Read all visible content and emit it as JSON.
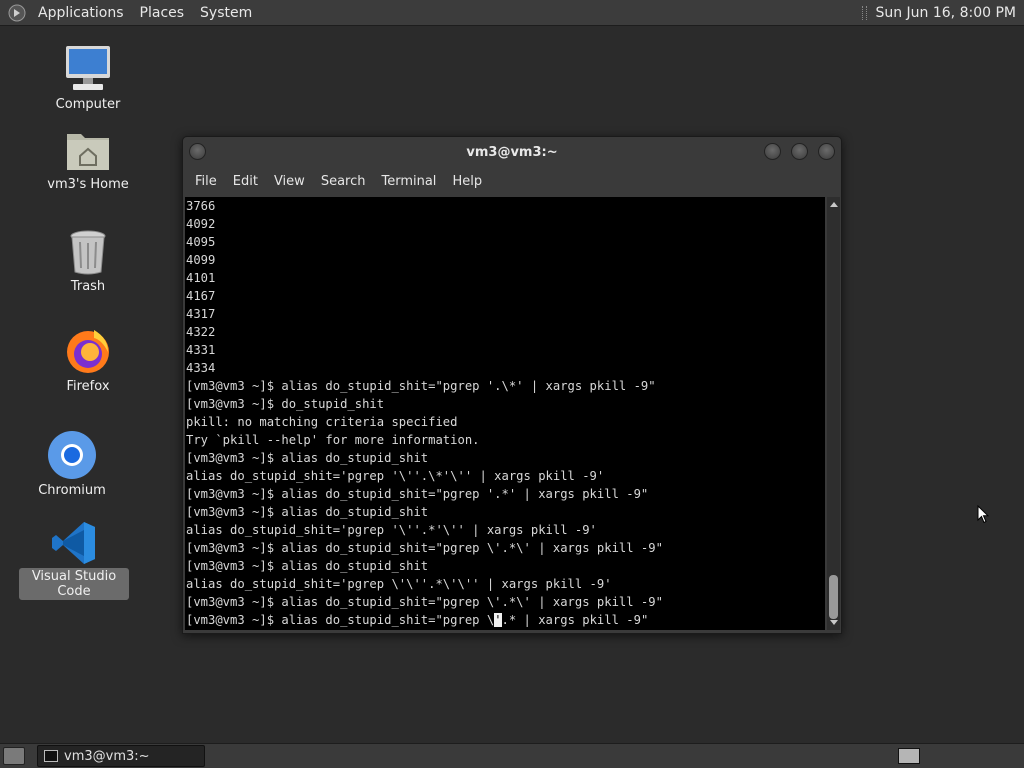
{
  "top_panel": {
    "menus": [
      "Applications",
      "Places",
      "System"
    ],
    "clock": "Sun Jun 16,  8:00 PM"
  },
  "desktop_icons": [
    {
      "label": "Computer",
      "icon": "computer-icon"
    },
    {
      "label": "vm3's Home",
      "icon": "home-folder-icon"
    },
    {
      "label": "Trash",
      "icon": "trash-icon"
    },
    {
      "label": "Firefox",
      "icon": "firefox-icon"
    },
    {
      "label": "Chromium",
      "icon": "chromium-icon"
    },
    {
      "label": "Visual Studio Code",
      "icon": "vscode-icon",
      "selected": true
    }
  ],
  "terminal": {
    "title": "vm3@vm3:~",
    "menus": [
      "File",
      "Edit",
      "View",
      "Search",
      "Terminal",
      "Help"
    ],
    "lines": [
      "3766",
      "4092",
      "4095",
      "4099",
      "4101",
      "4167",
      "4317",
      "4322",
      "4331",
      "4334",
      "[vm3@vm3 ~]$ alias do_stupid_shit=\"pgrep '.\\*' | xargs pkill -9\"",
      "[vm3@vm3 ~]$ do_stupid_shit",
      "pkill: no matching criteria specified",
      "Try `pkill --help' for more information.",
      "[vm3@vm3 ~]$ alias do_stupid_shit",
      "alias do_stupid_shit='pgrep '\\''.\\*'\\'' | xargs pkill -9'",
      "[vm3@vm3 ~]$ alias do_stupid_shit=\"pgrep '.*' | xargs pkill -9\"",
      "[vm3@vm3 ~]$ alias do_stupid_shit",
      "alias do_stupid_shit='pgrep '\\''.*'\\'' | xargs pkill -9'",
      "[vm3@vm3 ~]$ alias do_stupid_shit=\"pgrep \\'.*\\' | xargs pkill -9\"",
      "[vm3@vm3 ~]$ alias do_stupid_shit",
      "alias do_stupid_shit='pgrep \\'\\''.*\\'\\'' | xargs pkill -9'",
      "[vm3@vm3 ~]$ alias do_stupid_shit=\"pgrep \\'.*\\' | xargs pkill -9\""
    ],
    "last_line_before_cursor": "[vm3@vm3 ~]$ alias do_stupid_shit=\"pgrep \\",
    "cursor_char": "'",
    "last_line_after_cursor": ".* | xargs pkill -9\""
  },
  "taskbar": {
    "window_button": "vm3@vm3:~"
  },
  "colors": {
    "desktop": "#2b2b2b",
    "panel": "#3c3c3c",
    "terminal_bg": "#000000",
    "terminal_fg": "#d8d8d8"
  }
}
